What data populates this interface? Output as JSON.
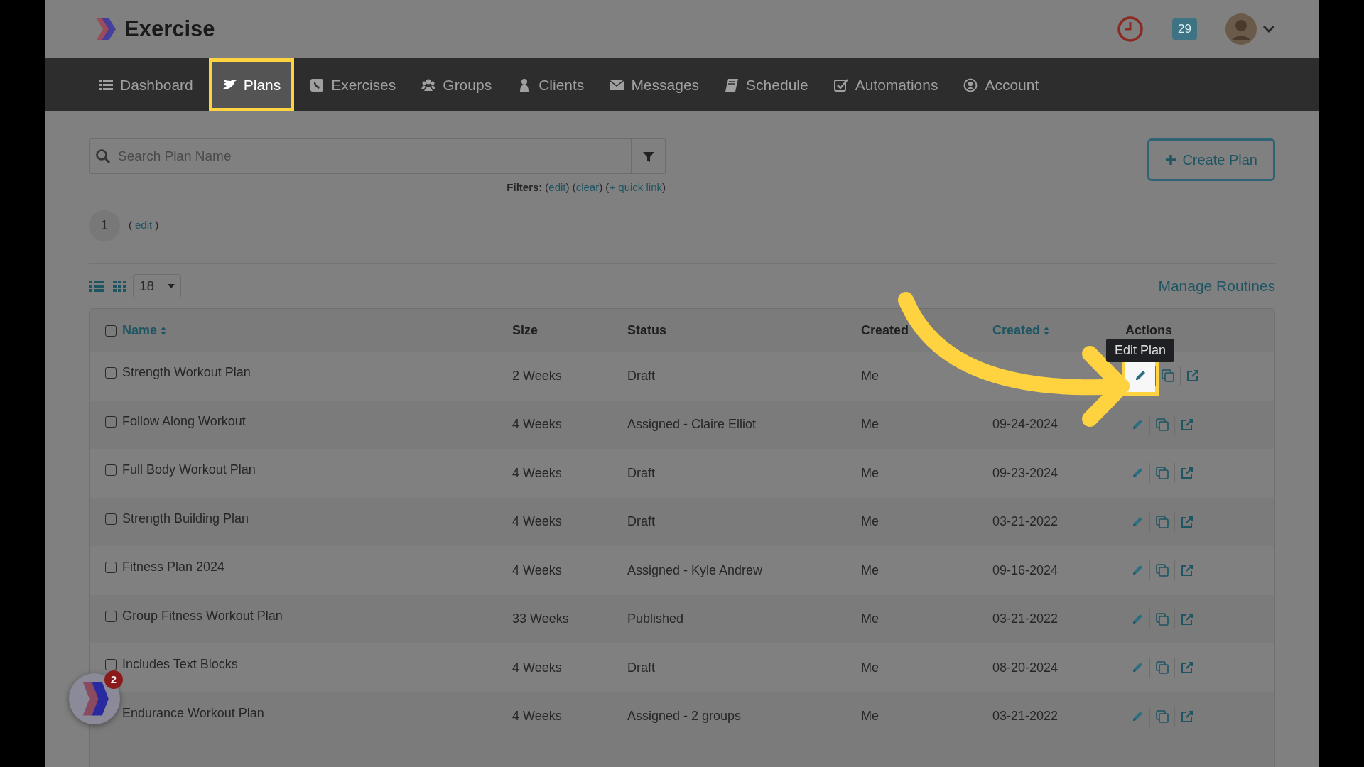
{
  "header": {
    "app_name": "Exercise",
    "notification_count": "29"
  },
  "nav": [
    {
      "label": "Dashboard",
      "selected": false
    },
    {
      "label": "Plans",
      "selected": true
    },
    {
      "label": "Exercises",
      "selected": false
    },
    {
      "label": "Groups",
      "selected": false
    },
    {
      "label": "Clients",
      "selected": false
    },
    {
      "label": "Messages",
      "selected": false
    },
    {
      "label": "Schedule",
      "selected": false
    },
    {
      "label": "Automations",
      "selected": false
    },
    {
      "label": "Account",
      "selected": false
    }
  ],
  "search": {
    "placeholder": "Search Plan Name"
  },
  "create_button": "Create Plan",
  "filters": [
    {
      "text": "Filters:",
      "kind": "label"
    },
    {
      "text": "(",
      "kind": "punct"
    },
    {
      "text": "edit",
      "kind": "link"
    },
    {
      "text": ") (",
      "kind": "punct"
    },
    {
      "text": "clear",
      "kind": "link"
    },
    {
      "text": ") (",
      "kind": "punct"
    },
    {
      "text": "+ quick link",
      "kind": "link"
    },
    {
      "text": ")",
      "kind": "punct"
    }
  ],
  "page_marker": {
    "number": "1",
    "parts": [
      {
        "text": "(",
        "kind": "punct"
      },
      {
        "text": "edit",
        "kind": "link"
      },
      {
        "text": ")",
        "kind": "punct"
      }
    ]
  },
  "per_page": "18",
  "manage_link": "Manage Routines",
  "table": {
    "select_all_checked": false,
    "columns": [
      {
        "label": "Name",
        "sortable": true
      },
      {
        "label": "Size",
        "sortable": false
      },
      {
        "label": "Status",
        "sortable": false
      },
      {
        "label": "Created",
        "sortable": false
      },
      {
        "label": "Created",
        "sortable": true
      },
      {
        "label": "Actions",
        "sortable": false
      }
    ],
    "rows": [
      {
        "name": "Strength Workout Plan",
        "size": "2 Weeks",
        "status": "Draft",
        "created_by": "Me",
        "checked": false,
        "highlighted": true
      },
      {
        "name": "Follow Along Workout",
        "size": "4 Weeks",
        "status": "Assigned - Claire Elliot",
        "created_by": "Me",
        "created": "09-24-2024",
        "checked": false,
        "highlighted": false
      },
      {
        "name": "Full Body Workout Plan",
        "size": "4 Weeks",
        "status": "Draft",
        "created_by": "Me",
        "created": "09-23-2024",
        "checked": false,
        "highlighted": false
      },
      {
        "name": "Strength Building Plan",
        "size": "4 Weeks",
        "status": "Draft",
        "created_by": "Me",
        "created": "03-21-2022",
        "checked": false,
        "highlighted": false
      },
      {
        "name": "Fitness Plan 2024",
        "size": "4 Weeks",
        "status": "Assigned - Kyle Andrew",
        "created_by": "Me",
        "created": "09-16-2024",
        "checked": false,
        "highlighted": false
      },
      {
        "name": "Group Fitness Workout Plan",
        "size": "33 Weeks",
        "status": "Published",
        "created_by": "Me",
        "created": "03-21-2022",
        "checked": false,
        "highlighted": false
      },
      {
        "name": "Includes Text Blocks",
        "size": "4 Weeks",
        "status": "Draft",
        "created_by": "Me",
        "created": "08-20-2024",
        "checked": false,
        "highlighted": false
      },
      {
        "name": "Endurance Workout Plan",
        "size": "4 Weeks",
        "status": "Assigned - 2 groups",
        "created_by": "Me",
        "created": "03-21-2022",
        "highlighted": false
      }
    ]
  },
  "tooltip": "Edit Plan",
  "helper_badge": "2"
}
